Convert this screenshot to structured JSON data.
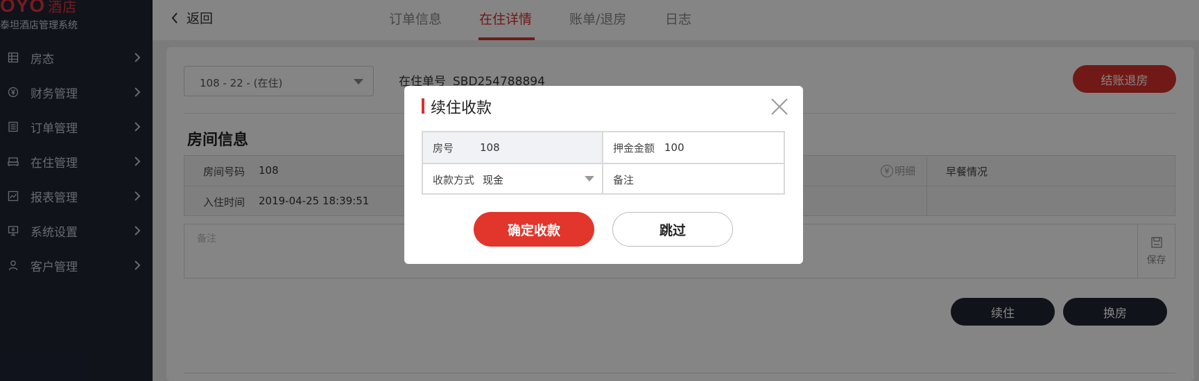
{
  "brand": {
    "logo_text": "OYO",
    "logo_hotel": "酒店",
    "system_name": "泰坦酒店管理系统"
  },
  "sidebar": {
    "items": [
      {
        "label": "房态",
        "icon": "grid-icon"
      },
      {
        "label": "财务管理",
        "icon": "yen-circle-icon"
      },
      {
        "label": "订单管理",
        "icon": "list-icon"
      },
      {
        "label": "在住管理",
        "icon": "bed-icon"
      },
      {
        "label": "报表管理",
        "icon": "chart-icon"
      },
      {
        "label": "系统设置",
        "icon": "monitor-icon"
      },
      {
        "label": "客户管理",
        "icon": "user-icon"
      }
    ]
  },
  "header": {
    "back_label": "返回",
    "tabs": [
      {
        "label": "订单信息",
        "active": false
      },
      {
        "label": "在住详情",
        "active": true
      },
      {
        "label": "账单/退房",
        "active": false
      },
      {
        "label": "日志",
        "active": false
      }
    ]
  },
  "main": {
    "room_select_value": "108 - 22 - (在住)",
    "order_no_label": "在住单号",
    "order_no_value": "SBD254788894",
    "checkout_button": "结账退房",
    "section_title": "房间信息",
    "room_no_label": "房间号码",
    "room_no_value": "108",
    "checkin_time_label": "入住时间",
    "checkin_time_value": "2019-04-25 18:39:51",
    "detail_icon_text": "¥",
    "detail_label": "明细",
    "breakfast_label": "早餐情况",
    "remark_placeholder": "备注",
    "save_label": "保存",
    "extend_button": "续住",
    "change_room_button": "换房"
  },
  "modal": {
    "title": "续住收款",
    "room_label": "房号",
    "room_value": "108",
    "deposit_label": "押金金额",
    "deposit_value": "100",
    "payment_label": "收款方式",
    "payment_value": "现金",
    "remark_placeholder": "备注",
    "confirm_button": "确定收款",
    "skip_button": "跳过"
  },
  "colors": {
    "accent": "#d9312b",
    "sidebar_bg": "#1f2533",
    "dark_button": "#1f2533"
  }
}
